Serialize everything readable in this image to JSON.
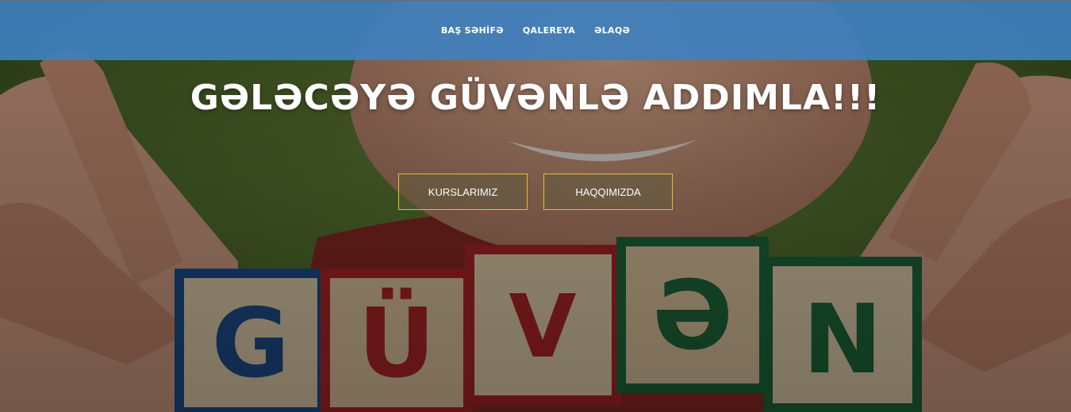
{
  "nav": {
    "items": [
      {
        "label": "BAŞ SƏHİFƏ"
      },
      {
        "label": "QALEREYA"
      },
      {
        "label": "ƏLAQƏ"
      }
    ]
  },
  "hero": {
    "headline": "GƏLƏCƏYƏ GÜVƏNLƏ ADDIMLA!!!",
    "buttons": [
      {
        "label": "KURSLARIMIZ"
      },
      {
        "label": "HAQQIMIZDA"
      }
    ],
    "blocks": [
      {
        "letter": "G",
        "color": "#1f4f8f"
      },
      {
        "letter": "Ü",
        "color": "#b3262a"
      },
      {
        "letter": "V",
        "color": "#b3262a"
      },
      {
        "letter": "Ə",
        "color": "#1f6b3c"
      },
      {
        "letter": "N",
        "color": "#1f6b3c"
      }
    ]
  },
  "colors": {
    "navbar": "#3f80be",
    "button_border": "#e8c21a"
  }
}
